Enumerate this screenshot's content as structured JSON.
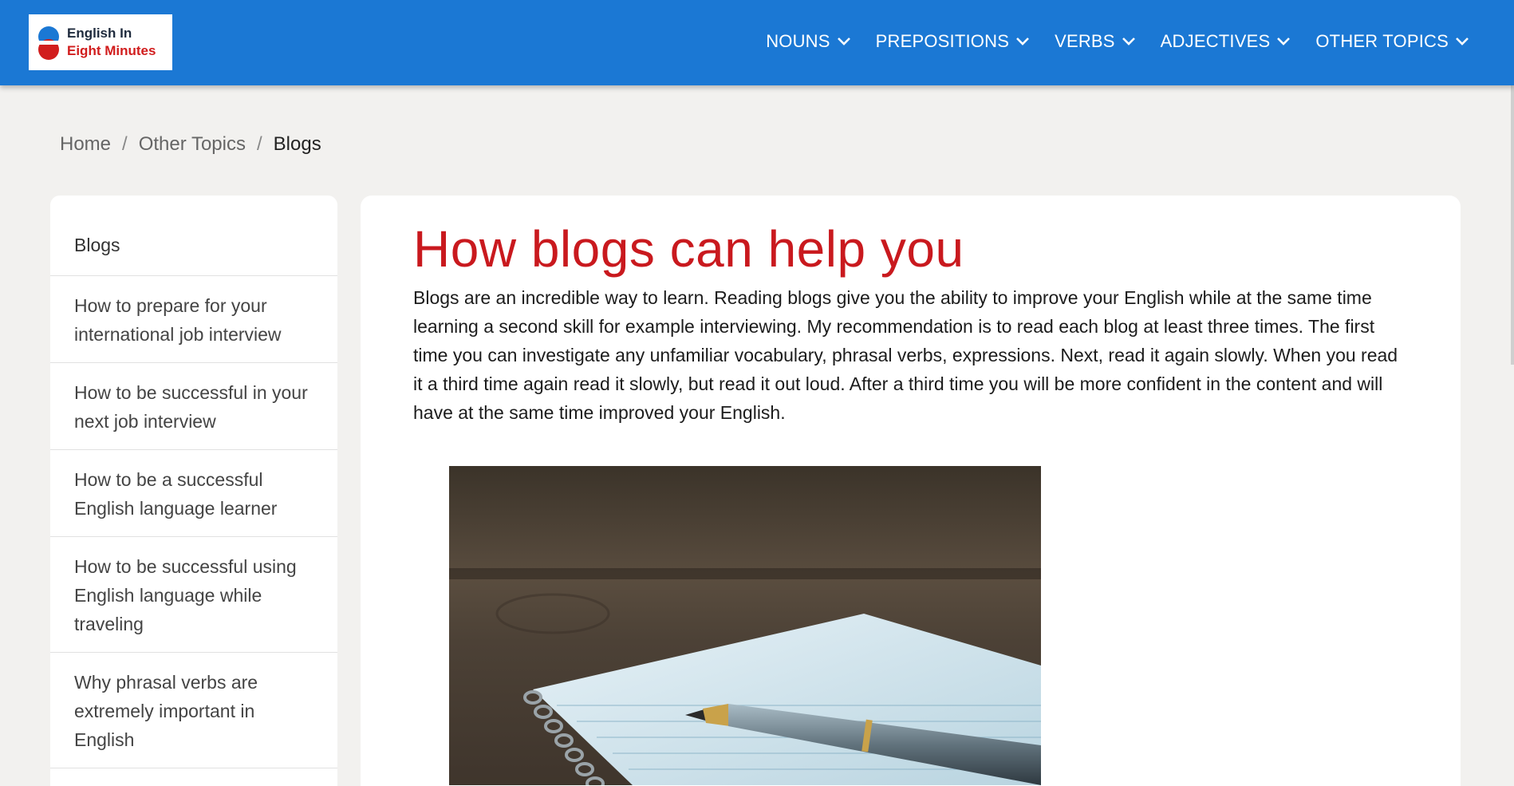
{
  "logo": {
    "line1": "English In",
    "line2": "Eight Minutes"
  },
  "nav": [
    {
      "label": "NOUNS",
      "icon": "chevron-down-icon"
    },
    {
      "label": "PREPOSITIONS",
      "icon": "chevron-down-icon"
    },
    {
      "label": "VERBS",
      "icon": "chevron-down-icon"
    },
    {
      "label": "ADJECTIVES",
      "icon": "chevron-down-icon"
    },
    {
      "label": "OTHER TOPICS",
      "icon": "chevron-down-icon"
    }
  ],
  "breadcrumb": {
    "items": [
      "Home",
      "Other Topics",
      "Blogs"
    ],
    "separator": "/"
  },
  "sidebar": {
    "items": [
      "Blogs",
      "How to prepare for your international job interview",
      "How to be successful in your next job interview",
      "How to be a successful English language learner",
      "How to be successful using English language while traveling",
      "Why phrasal verbs are extremely important in English"
    ]
  },
  "main": {
    "title": "How blogs can help you",
    "paragraph": "Blogs are an incredible way to learn. Reading blogs give you the ability to improve your English while at the same time learning a second skill for example interviewing. My recommendation is to read each blog at least three times. The first time you can investigate any unfamiliar vocabulary, phrasal verbs, expressions. Next, read it again slowly. When you read it a third time again read it slowly, but read it out loud. After a third time you will be more confident in the content and will have at the same time improved your English."
  },
  "colors": {
    "brand_blue": "#1b78d4",
    "title_red": "#c9191e",
    "page_bg": "#f2f1ef"
  }
}
